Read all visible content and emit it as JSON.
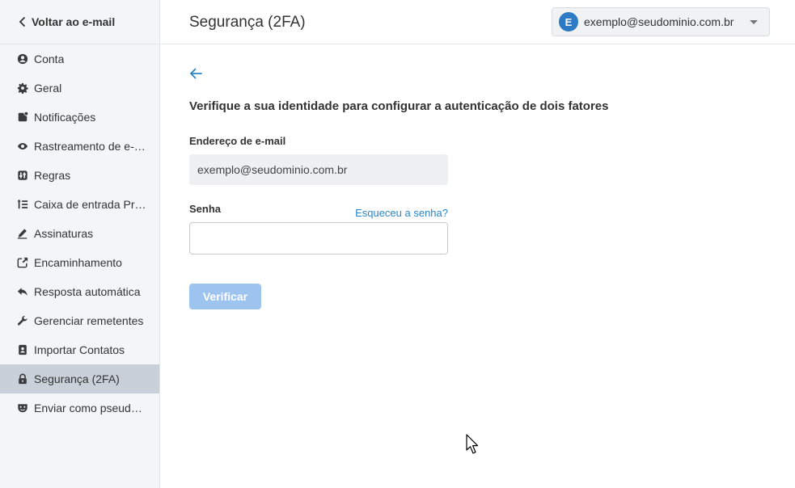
{
  "sidebar": {
    "back_label": "Voltar ao e-mail",
    "items": [
      {
        "label": "Conta",
        "icon": "user-circle-icon"
      },
      {
        "label": "Geral",
        "icon": "gear-icon"
      },
      {
        "label": "Notificações",
        "icon": "notification-icon"
      },
      {
        "label": "Rastreamento de e-…",
        "icon": "eye-icon"
      },
      {
        "label": "Regras",
        "icon": "rules-icon"
      },
      {
        "label": "Caixa de entrada Pri…",
        "icon": "priority-list-icon"
      },
      {
        "label": "Assinaturas",
        "icon": "pen-icon"
      },
      {
        "label": "Encaminhamento",
        "icon": "forward-icon"
      },
      {
        "label": "Resposta automática",
        "icon": "reply-icon"
      },
      {
        "label": "Gerenciar remetentes",
        "icon": "wrench-icon"
      },
      {
        "label": "Importar Contatos",
        "icon": "contact-book-icon"
      },
      {
        "label": "Segurança (2FA)",
        "icon": "lock-icon",
        "active": true
      },
      {
        "label": "Enviar como pseud…",
        "icon": "mask-icon"
      }
    ]
  },
  "header": {
    "title": "Segurança (2FA)",
    "account": {
      "initial": "E",
      "email": "exemplo@seudominio.com.br"
    }
  },
  "main": {
    "heading": "Verifique a sua identidade para configurar a autenticação de dois fatores",
    "email_label": "Endereço de e-mail",
    "email_value": "exemplo@seudominio.com.br",
    "password_label": "Senha",
    "password_value": "",
    "forgot_label": "Esqueceu a senha?",
    "verify_label": "Verificar"
  },
  "colors": {
    "accent": "#2d7bc4",
    "link": "#2a86c9",
    "button_disabled": "#9dc3ef",
    "active_nav": "#c9d0da"
  }
}
